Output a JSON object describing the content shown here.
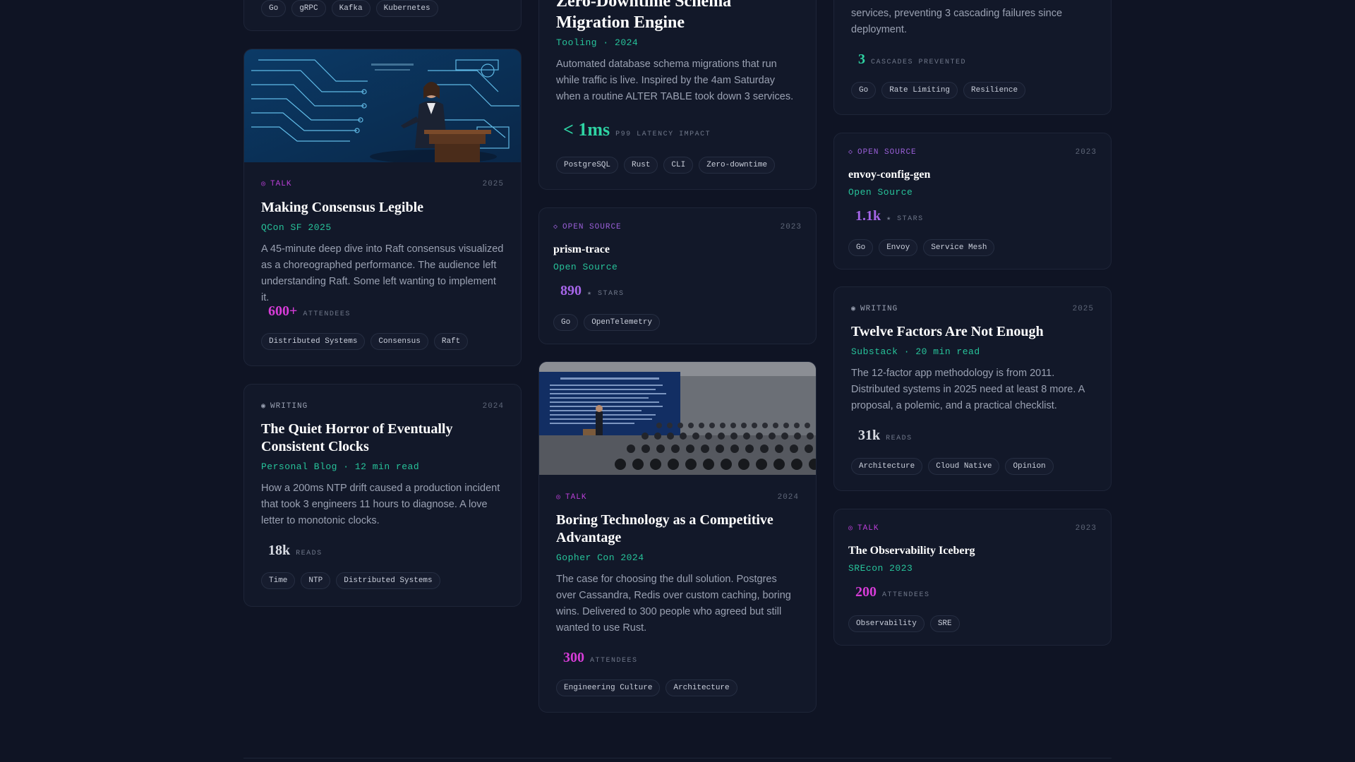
{
  "cards": {
    "top_left_tags": [
      "Go",
      "gRPC",
      "Kafka",
      "Kubernetes"
    ],
    "consensus": {
      "kind": "TALK",
      "year": "2025",
      "title": "Making Consensus Legible",
      "meta": "QCon SF 2025",
      "desc": "A 45-minute deep dive into Raft consensus visualized as a choreographed performance. The audience left understanding Raft. Some left wanting to implement it.",
      "metric_value": "600+",
      "metric_unit": "ATTENDEES",
      "tags": [
        "Distributed Systems",
        "Consensus",
        "Raft"
      ]
    },
    "clocks": {
      "kind": "WRITING",
      "year": "2024",
      "title": "The Quiet Horror of Eventually Consistent Clocks",
      "meta": "Personal Blog · 12 min read",
      "desc": "How a 200ms NTP drift caused a production incident that took 3 engineers 11 hours to diagnose. A love letter to monotonic clocks.",
      "metric_value": "18k",
      "metric_unit": "READS",
      "tags": [
        "Time",
        "NTP",
        "Distributed Systems"
      ]
    },
    "migration": {
      "title": "Zero-Downtime Schema Migration Engine",
      "meta": "Tooling · 2024",
      "desc": "Automated database schema migrations that run while traffic is live. Inspired by the 4am Saturday when a routine ALTER TABLE took down 3 services.",
      "metric_value": "< 1ms",
      "metric_unit": "P99 LATENCY IMPACT",
      "tags": [
        "PostgreSQL",
        "Rust",
        "CLI",
        "Zero-downtime"
      ]
    },
    "prism": {
      "kind": "OPEN SOURCE",
      "year": "2023",
      "title": "prism-trace",
      "meta": "Open Source",
      "metric_value": "890",
      "metric_unit": "★ STARS",
      "tags": [
        "Go",
        "OpenTelemetry"
      ]
    },
    "boring": {
      "kind": "TALK",
      "year": "2024",
      "title": "Boring Technology as a Competitive Advantage",
      "meta": "Gopher Con 2024",
      "desc": "The case for choosing the dull solution. Postgres over Cassandra, Redis over custom caching, boring wins. Delivered to 300 people who agreed but still wanted to use Rust.",
      "metric_value": "300",
      "metric_unit": "ATTENDEES",
      "tags": [
        "Engineering Culture",
        "Architecture"
      ]
    },
    "ratelimit": {
      "desc": "services, preventing 3 cascading failures since deployment.",
      "metric_value": "3",
      "metric_unit": "CASCADES PREVENTED",
      "tags": [
        "Go",
        "Rate Limiting",
        "Resilience"
      ]
    },
    "envoy": {
      "kind": "OPEN SOURCE",
      "year": "2023",
      "title": "envoy-config-gen",
      "meta": "Open Source",
      "metric_value": "1.1k",
      "metric_unit": "★ STARS",
      "tags": [
        "Go",
        "Envoy",
        "Service Mesh"
      ]
    },
    "twelve": {
      "kind": "WRITING",
      "year": "2025",
      "title": "Twelve Factors Are Not Enough",
      "meta": "Substack · 20 min read",
      "desc": "The 12-factor app methodology is from 2011. Distributed systems in 2025 need at least 8 more. A proposal, a polemic, and a practical checklist.",
      "metric_value": "31k",
      "metric_unit": "READS",
      "tags": [
        "Architecture",
        "Cloud Native",
        "Opinion"
      ]
    },
    "iceberg": {
      "kind": "TALK",
      "year": "2023",
      "title": "The Observability Iceberg",
      "meta": "SREcon 2023",
      "metric_value": "200",
      "metric_unit": "ATTENDEES",
      "tags": [
        "Observability",
        "SRE"
      ]
    }
  },
  "icons": {
    "talk": "target-icon",
    "writing": "dot-icon",
    "oss": "diamond-icon"
  },
  "colors": {
    "background": "#0f1424",
    "card": "#121829",
    "accent_green": "#27c39a",
    "talk_purple": "#b93fd6",
    "oss_purple": "#9a5fd8",
    "metric_green": "#2ed3a3",
    "metric_magenta": "#d53cd6",
    "metric_purple": "#a565e8"
  }
}
